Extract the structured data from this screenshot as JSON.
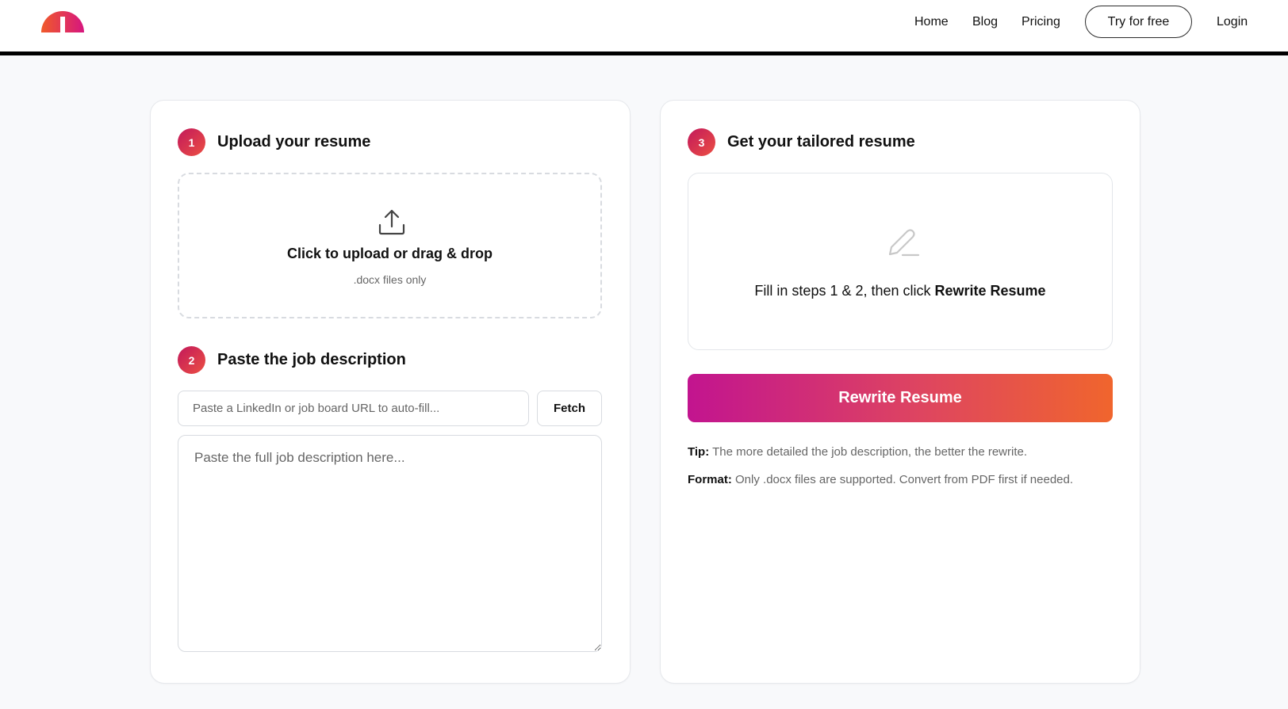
{
  "header": {
    "logo_icon": "half-circle-logo-icon",
    "nav": {
      "home": "Home",
      "blog": "Blog",
      "pricing": "Pricing",
      "try_free": "Try for free",
      "login": "Login"
    }
  },
  "step1": {
    "number": "1",
    "title": "Upload your resume",
    "upload_icon": "upload-icon",
    "dropzone_title": "Click to upload or drag & drop",
    "dropzone_sub": ".docx files only"
  },
  "step2": {
    "number": "2",
    "title": "Paste the job description",
    "url_placeholder": "Paste a LinkedIn or job board URL to auto-fill...",
    "fetch_label": "Fetch",
    "jd_placeholder": "Paste the full job description here..."
  },
  "step3": {
    "number": "3",
    "title": "Get your tailored resume",
    "empty_icon": "pen-icon",
    "empty_message_prefix": "Fill in steps 1 & 2, then click ",
    "empty_message_bold": "Rewrite Resume",
    "rewrite_label": "Rewrite Resume",
    "tip_label": "Tip:",
    "tip_text": " The more detailed the job description, the better the rewrite.",
    "format_label": "Format:",
    "format_text": " Only .docx files are supported. Convert from PDF first if needed."
  },
  "colors": {
    "accent_start": "#c2148f",
    "accent_mid": "#de4560",
    "accent_end": "#f0652d",
    "badge": "#d8365a"
  }
}
